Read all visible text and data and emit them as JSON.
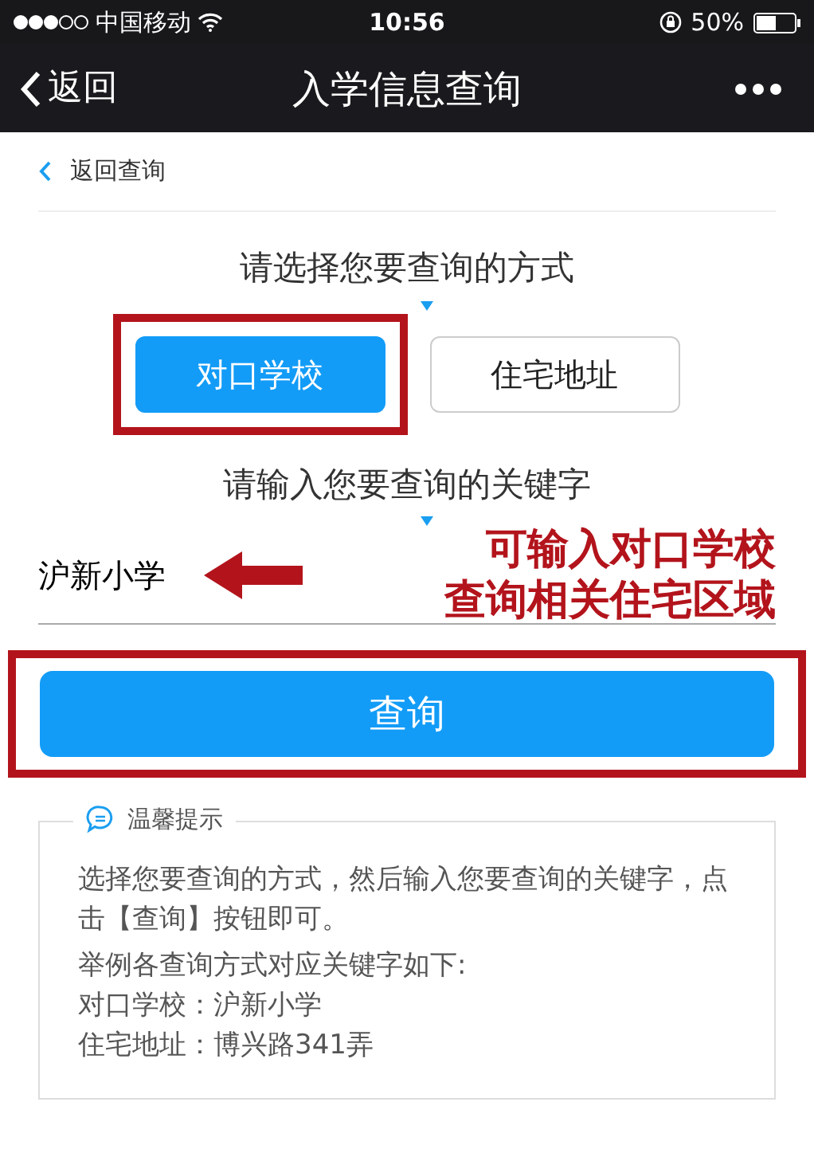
{
  "status_bar": {
    "carrier": "中国移动",
    "time": "10:56",
    "battery": "50%"
  },
  "nav_bar": {
    "back": "返回",
    "title": "入学信息查询"
  },
  "back_link": "返回查询",
  "mode_prompt": "请选择您要查询的方式",
  "modes": [
    {
      "label": "对口学校",
      "selected": true,
      "highlighted": true
    },
    {
      "label": "住宅地址",
      "selected": false,
      "highlighted": false
    }
  ],
  "keyword_prompt": "请输入您要查询的关键字",
  "keyword": {
    "value": "沪新小学"
  },
  "annotation": [
    "可输入对口学校",
    "查询相关住宅区域"
  ],
  "query_button": {
    "label": "查询",
    "highlighted": true
  },
  "tips": {
    "title": "温馨提示",
    "paragraphs": [
      "选择您要查询的方式，然后输入您要查询的关键字，点击【查询】按钮即可。",
      "举例各查询方式对应关键字如下:",
      "对口学校：沪新小学",
      "住宅地址：博兴路341弄"
    ]
  }
}
